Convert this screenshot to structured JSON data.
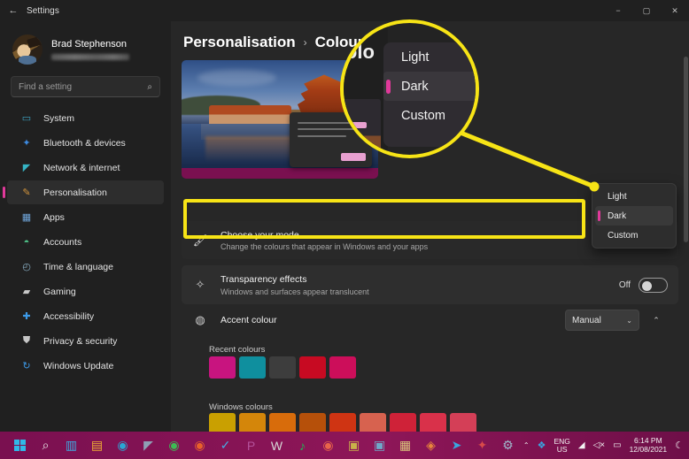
{
  "window": {
    "title": "Settings",
    "back_icon": "back-arrow-icon",
    "minimize": "−",
    "maximize": "▢",
    "close": "✕"
  },
  "sidebar": {
    "profile": {
      "name": "Brad Stephenson",
      "email_redacted": true
    },
    "search": {
      "placeholder": "Find a setting",
      "icon": "search-icon"
    },
    "items": [
      {
        "label": "System",
        "icon": "display-icon",
        "color": "#3fa9c9",
        "glyph": "▭",
        "active": false
      },
      {
        "label": "Bluetooth & devices",
        "icon": "bluetooth-icon",
        "color": "#3d8ae0",
        "glyph": "✦",
        "active": false
      },
      {
        "label": "Network & internet",
        "icon": "wifi-icon",
        "color": "#35b4c4",
        "glyph": "◤",
        "active": false
      },
      {
        "label": "Personalisation",
        "icon": "brush-icon",
        "color": "#d3953c",
        "glyph": "✎",
        "active": true
      },
      {
        "label": "Apps",
        "icon": "apps-icon",
        "color": "#6fa4d8",
        "glyph": "▦",
        "active": false
      },
      {
        "label": "Accounts",
        "icon": "account-icon",
        "color": "#4fc48a",
        "glyph": "◓",
        "active": false
      },
      {
        "label": "Time & language",
        "icon": "clock-icon",
        "color": "#8fb6cc",
        "glyph": "◴",
        "active": false
      },
      {
        "label": "Gaming",
        "icon": "gamepad-icon",
        "color": "#c8c8c8",
        "glyph": "▰",
        "active": false
      },
      {
        "label": "Accessibility",
        "icon": "accessibility-icon",
        "color": "#3d9ae8",
        "glyph": "✚",
        "active": false
      },
      {
        "label": "Privacy & security",
        "icon": "shield-icon",
        "color": "#c6c6c6",
        "glyph": "⛊",
        "active": false
      },
      {
        "label": "Windows Update",
        "icon": "update-icon",
        "color": "#3d9ae8",
        "glyph": "↻",
        "active": false
      }
    ]
  },
  "main": {
    "breadcrumb": {
      "parent": "Personalisation",
      "separator": "›",
      "current": "Colours"
    },
    "rows": {
      "mode": {
        "icon": "paint-roller-icon",
        "title": "Choose your mode",
        "subtitle": "Change the colours that appear in Windows and your apps",
        "highlighted": true
      },
      "transparency": {
        "icon": "transparency-icon",
        "title": "Transparency effects",
        "subtitle": "Windows and surfaces appear translucent",
        "toggle_label": "Off",
        "toggle_state": "off"
      },
      "accent": {
        "icon": "palette-icon",
        "title": "Accent colour",
        "combo_value": "Manual",
        "combo_chevron": "⌄",
        "expander_chevron": "⌃"
      }
    },
    "recent_colours": {
      "label": "Recent colours",
      "swatches": [
        "#c8147f",
        "#0f8f9e",
        "#3d3d3d",
        "#c70a22",
        "#cc0e5a"
      ]
    },
    "windows_colours": {
      "label": "Windows colours",
      "row1": [
        "#c9a001",
        "#d4860a",
        "#d86c0b",
        "#b6500a",
        "#cf3413",
        "#d7624f",
        "#cf2238",
        "#d9314a",
        "#d43f57"
      ],
      "row2": [
        "#cf1633",
        "#c8136a",
        "#bf1270",
        "#cc17a3",
        "#b81585",
        "#af3fb8",
        "#9a1fa8",
        "#0771b8",
        "#0f7fc0"
      ],
      "selected_index": 3,
      "selected_check": "✓"
    }
  },
  "mode_flyout": {
    "items": [
      {
        "label": "Light",
        "selected": false
      },
      {
        "label": "Dark",
        "selected": true
      },
      {
        "label": "Custom",
        "selected": false
      }
    ]
  },
  "magnifier": {
    "callout_colour": "#f7e416",
    "partial_crumb": "Colo",
    "items": [
      {
        "label": "Light",
        "selected": false
      },
      {
        "label": "Dark",
        "selected": true
      },
      {
        "label": "Custom",
        "selected": false
      }
    ]
  },
  "taskbar": {
    "icons": [
      {
        "name": "start-icon",
        "glyph": "",
        "color": "#30b8e8"
      },
      {
        "name": "search-icon",
        "glyph": "⌕",
        "color": "#e8e8e8"
      },
      {
        "name": "task-view-icon",
        "glyph": "▥",
        "color": "#3fa9e0"
      },
      {
        "name": "file-explorer-icon",
        "glyph": "▤",
        "color": "#f2b134"
      },
      {
        "name": "edge-icon",
        "glyph": "◉",
        "color": "#2aa7d4"
      },
      {
        "name": "onenote-icon",
        "glyph": "◤",
        "color": "#8f9fb5"
      },
      {
        "name": "chrome-icon",
        "glyph": "◉",
        "color": "#3dbb54"
      },
      {
        "name": "firefox-icon",
        "glyph": "◉",
        "color": "#e8612b"
      },
      {
        "name": "todo-icon",
        "glyph": "✓",
        "color": "#4aa8e0"
      },
      {
        "name": "powerpoint-icon",
        "glyph": "P",
        "color": "#b4529b"
      },
      {
        "name": "word-icon",
        "glyph": "W",
        "color": "#d8d8d8"
      },
      {
        "name": "spotify-icon",
        "glyph": "♪",
        "color": "#1db954"
      },
      {
        "name": "opera-icon",
        "glyph": "◉",
        "color": "#e8654a"
      },
      {
        "name": "app-icon-1",
        "glyph": "▣",
        "color": "#c9b14a"
      },
      {
        "name": "app-icon-2",
        "glyph": "▣",
        "color": "#6fa8c9"
      },
      {
        "name": "store-icon",
        "glyph": "▦",
        "color": "#d8c27a"
      },
      {
        "name": "brave-icon",
        "glyph": "◈",
        "color": "#e8863c"
      },
      {
        "name": "telegram-icon",
        "glyph": "➤",
        "color": "#3aa6e0"
      },
      {
        "name": "bluetooth-tray-icon",
        "glyph": "✦",
        "color": "#d84a4a"
      },
      {
        "name": "settings-icon",
        "glyph": "⚙",
        "color": "#9fb8cc"
      }
    ],
    "tray": {
      "overflow_chevron": "⌃",
      "dropbox_icon": "dropbox-icon",
      "language": {
        "line1": "ENG",
        "line2": "US"
      },
      "wifi_icon": "wifi-tray-icon",
      "volume_icon": "volume-muted-icon",
      "battery_icon": "battery-icon",
      "time": "6:14 PM",
      "date": "12/08/2021",
      "notification_icon": "moon-icon"
    }
  }
}
